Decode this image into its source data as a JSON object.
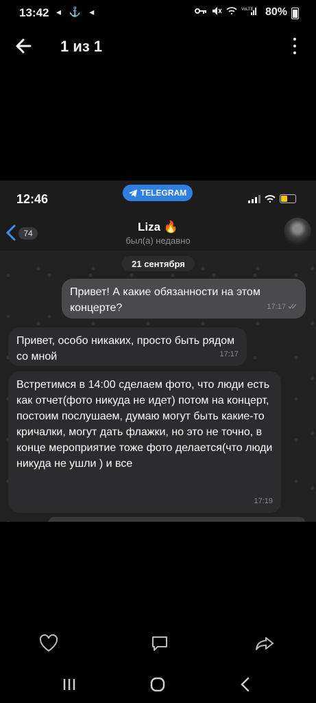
{
  "status_bar": {
    "time": "13:42",
    "left_icons": "◂ ⚓ ◂",
    "battery": "80%"
  },
  "viewer": {
    "counter": "1 из 1"
  },
  "screenshot": {
    "ios_time": "12:46",
    "telegram_pill": "TELEGRAM",
    "chat": {
      "back_badge": "74",
      "name": "Liza 🔥",
      "status": "был(а) недавно",
      "date": "21 сентября",
      "messages": [
        {
          "direction": "out",
          "text": "Привет! А какие обязанности на этом концерте?",
          "time": "17:17"
        },
        {
          "direction": "in",
          "text": "Привет, особо никаких, просто быть рядом со мной",
          "time": "17:17"
        },
        {
          "direction": "in",
          "text": "Встретимся в 14:00 сделаем фото, что люди есть как отчет(фото никуда не идет) потом на концерт, постоим послушаем, думаю могут быть какие-то кричалки, могут дать флажки, но это не точно, в конце мероприятие тоже фото делается(что люди никуда не ушли ) и все",
          "time": "17:19"
        }
      ]
    }
  },
  "actions": {
    "like": "heart-icon",
    "comment": "comment-icon",
    "share": "share-icon"
  }
}
